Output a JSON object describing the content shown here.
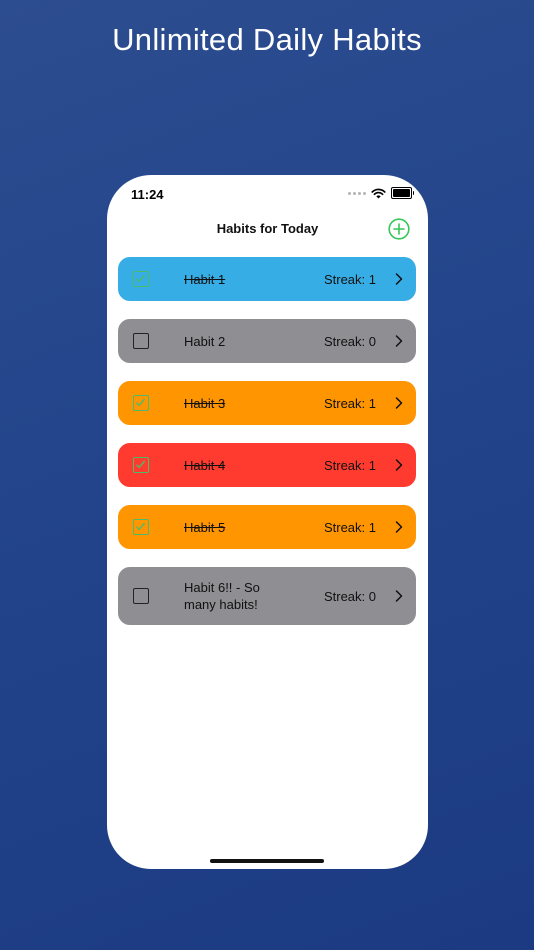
{
  "headline": "Unlimited Daily Habits",
  "status_bar": {
    "time": "11:24"
  },
  "nav": {
    "title": "Habits for Today"
  },
  "colors": {
    "blue": "#37ade6",
    "gray": "#8e8e93",
    "orange": "#ff9500",
    "red": "#ff3b30",
    "check_green": "#4cbc6a"
  },
  "habits": [
    {
      "name": "Habit 1",
      "streak": "Streak: 1",
      "done": true,
      "color": "#37ade6"
    },
    {
      "name": "Habit 2",
      "streak": "Streak: 0",
      "done": false,
      "color": "#8e8e93"
    },
    {
      "name": "Habit 3",
      "streak": "Streak: 1",
      "done": true,
      "color": "#ff9500"
    },
    {
      "name": "Habit 4",
      "streak": "Streak: 1",
      "done": true,
      "color": "#ff3b30"
    },
    {
      "name": "Habit 5",
      "streak": "Streak: 1",
      "done": true,
      "color": "#ff9500"
    },
    {
      "name": "Habit 6!! - So many habits!",
      "streak": "Streak: 0",
      "done": false,
      "color": "#8e8e93"
    }
  ]
}
